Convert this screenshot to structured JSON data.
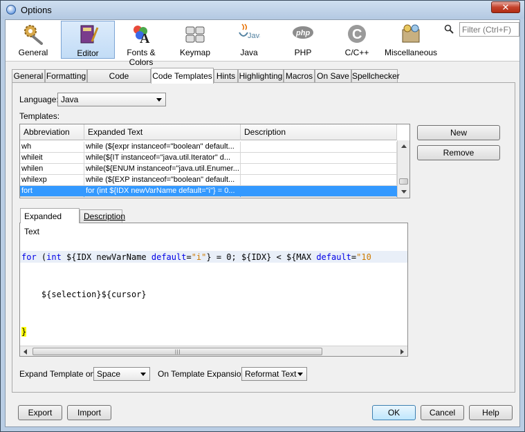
{
  "window": {
    "title": "Options",
    "close_glyph": "✕"
  },
  "categories": [
    {
      "label": "General",
      "icon": "gears-icon"
    },
    {
      "label": "Editor",
      "icon": "editor-book-icon",
      "selected": true
    },
    {
      "label": "Fonts & Colors",
      "icon": "fonts-colors-icon"
    },
    {
      "label": "Keymap",
      "icon": "keyboard-icon"
    },
    {
      "label": "Java",
      "icon": "java-cup-icon"
    },
    {
      "label": "PHP",
      "icon": "php-icon"
    },
    {
      "label": "C/C++",
      "icon": "cpp-icon"
    },
    {
      "label": "Miscellaneous",
      "icon": "misc-icon"
    }
  ],
  "filter": {
    "placeholder": "Filter (Ctrl+F)"
  },
  "subtabs": [
    "General",
    "Formatting",
    "Code Completion",
    "Code Templates",
    "Hints",
    "Highlighting",
    "Macros",
    "On Save",
    "Spellchecker"
  ],
  "active_subtab": "Code Templates",
  "language": {
    "label": "Language:",
    "value": "Java"
  },
  "templates_label": "Templates:",
  "table": {
    "columns": [
      "Abbreviation",
      "Expanded Text",
      "Description"
    ],
    "rows": [
      {
        "abbr": "wh",
        "text": "while (${expr instanceof=\"boolean\" default...",
        "desc": ""
      },
      {
        "abbr": "whileit",
        "text": "while(${IT instanceof=\"java.util.Iterator\" d...",
        "desc": ""
      },
      {
        "abbr": "whilen",
        "text": "while(${ENUM instanceof=\"java.util.Enumer...",
        "desc": ""
      },
      {
        "abbr": "whilexp",
        "text": "while (${EXP instanceof=\"boolean\" default...",
        "desc": ""
      },
      {
        "abbr": "fort",
        "text": "for (int ${IDX newVarName default=\"i\"} = 0...",
        "desc": "",
        "selected": true
      }
    ]
  },
  "buttons": {
    "new": "New",
    "remove": "Remove"
  },
  "editor_tabs": [
    "Expanded Text",
    "Description"
  ],
  "code": {
    "l1": {
      "kw1": "for",
      "t1": " (",
      "kw2": "int",
      "t2": " ${IDX newVarName ",
      "kw3": "default",
      "t3": "=",
      "s1": "\"i\"",
      "t4": "} = 0; ${IDX} < ${MAX ",
      "kw4": "default",
      "t5": "=",
      "s2": "\"10"
    },
    "l2": "    ${selection}${cursor}",
    "l3": "}"
  },
  "expand_on": {
    "label": "Expand Template on:",
    "value": "Space"
  },
  "on_expansion": {
    "label": "On Template Expansion:",
    "value": "Reformat Text"
  },
  "bottom_buttons": {
    "export": "Export",
    "import": "Import",
    "ok": "OK",
    "cancel": "Cancel",
    "help": "Help"
  },
  "scroll_grip": "|||"
}
